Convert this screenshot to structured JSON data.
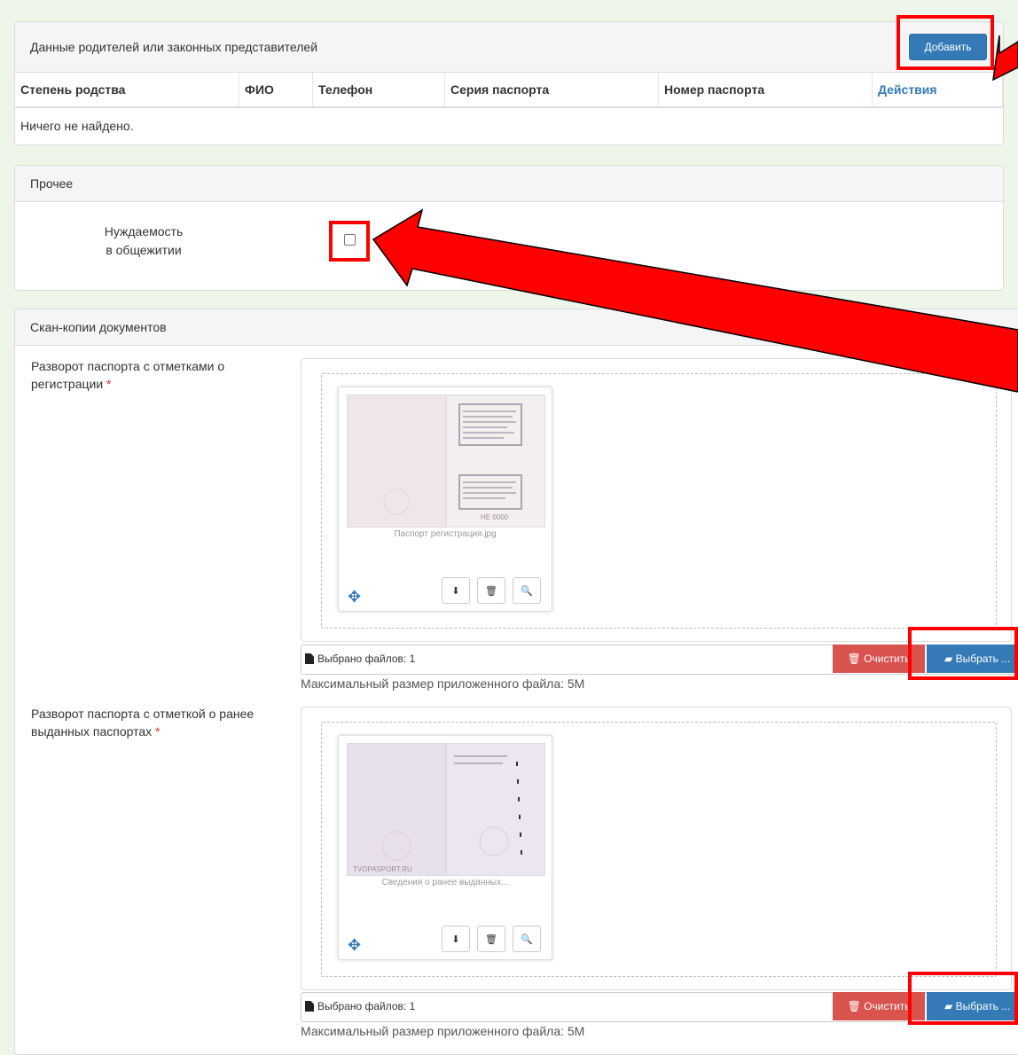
{
  "parents": {
    "title": "Данные родителей или законных представителей",
    "add_label": "Добавить",
    "columns": [
      "Степень родства",
      "ФИО",
      "Телефон",
      "Серия паспорта",
      "Номер паспорта",
      "Действия"
    ],
    "empty_text": "Ничего не найдено."
  },
  "other": {
    "title": "Прочее",
    "dorm_label_line1": "Нуждаемость",
    "dorm_label_line2": "в общежитии",
    "dorm_checked": false
  },
  "scans": {
    "title": "Скан-копии документов",
    "items": [
      {
        "label": "Разворот паспорта с отметками о регистрации",
        "file_name": "Паспорт регистрация.jpg",
        "files_selected": "Выбрано файлов: 1",
        "clear_label": "Очистить",
        "choose_label": "Выбрать ...",
        "max_size": "Максимальный размер приложенного файла: 5M"
      },
      {
        "label": "Разворот паспорта с отметкой о ранее выданных паспортах",
        "file_name": "Сведения о ранее выданных...",
        "files_selected": "Выбрано файлов: 1",
        "clear_label": "Очистить",
        "choose_label": "Выбрать ...",
        "max_size": "Максимальный размер приложенного файла: 5M"
      }
    ],
    "required_mark": "*"
  },
  "colors": {
    "primary": "#337ab7",
    "danger": "#d9534f",
    "highlight": "#ff0000",
    "background": "#eef6e9"
  },
  "icons": [
    "move-icon",
    "download-icon",
    "trash-icon",
    "zoom-icon",
    "file-icon",
    "folder-icon",
    "trash-icon"
  ]
}
